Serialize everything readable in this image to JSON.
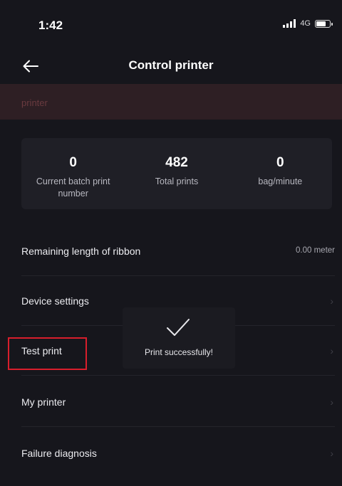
{
  "status_bar": {
    "time": "1:42",
    "network": "4G",
    "battery_level": 0.75,
    "icons": [
      "signal-icon",
      "battery-icon"
    ]
  },
  "nav": {
    "title": "Control printer",
    "back_icon": "arrow-left-icon"
  },
  "printer_strip": {
    "label": "printer",
    "background": "#2e1f24",
    "text_color": "#6a3a3f"
  },
  "stats": [
    {
      "value": "0",
      "label": "Current batch print number"
    },
    {
      "value": "482",
      "label": "Total prints"
    },
    {
      "value": "0",
      "label": "bag/minute"
    }
  ],
  "menu": {
    "remaining_label": "Remaining length of ribbon",
    "remaining_value": "0.00 meter",
    "device_settings": "Device settings",
    "test_print": "Test print",
    "my_printer": "My printer",
    "failure_diagnosis": "Failure diagnosis",
    "chevron": "›",
    "chevron_icon": "chevron-right-icon"
  },
  "toast": {
    "message": "Print successfully!",
    "icon": "checkmark-icon"
  },
  "colors": {
    "background": "#16161c",
    "card": "#1f1f26",
    "highlight": "#d81e2c",
    "text": "#f2f2f4",
    "muted": "#b8b8c0"
  }
}
